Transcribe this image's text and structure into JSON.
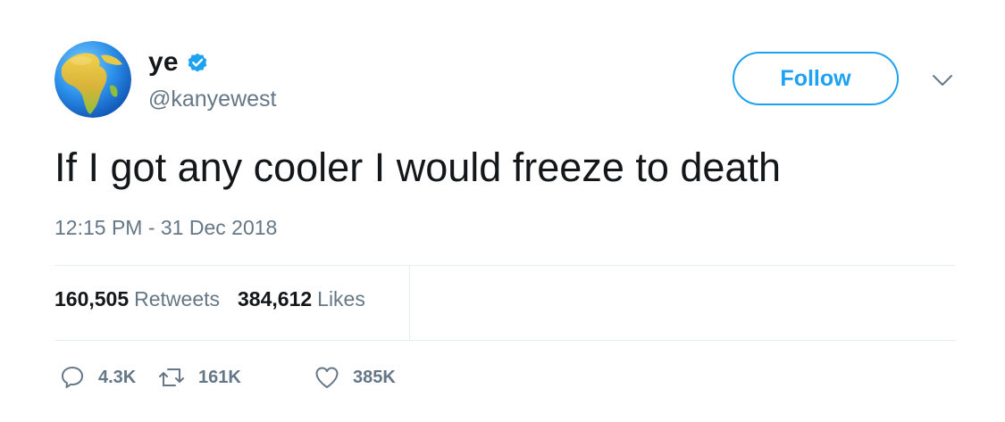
{
  "user": {
    "display_name": "ye",
    "handle": "@kanyewest",
    "verified": true,
    "avatar_icon": "earth-globe-africa-icon"
  },
  "follow_button": {
    "label": "Follow"
  },
  "menu": {
    "icon": "chevron-down-icon"
  },
  "tweet": {
    "text": "If I got any cooler I would freeze to death",
    "timestamp": "12:15 PM - 31 Dec 2018"
  },
  "stats": {
    "retweets_count": "160,505",
    "retweets_label": "Retweets",
    "likes_count": "384,612",
    "likes_label": "Likes"
  },
  "actions": {
    "reply_count": "4.3K",
    "retweet_count": "161K",
    "like_count": "385K"
  },
  "colors": {
    "accent": "#1da1f2",
    "text": "#14171a",
    "secondary_text": "#657786",
    "divider": "#e6ecf0"
  }
}
